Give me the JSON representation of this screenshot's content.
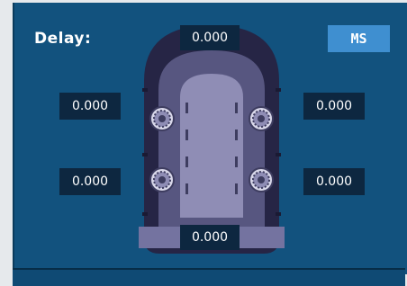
{
  "title": "Delay:",
  "unit_button": "MS",
  "delays": {
    "center": "0.000",
    "front_left": "0.000",
    "front_right": "0.000",
    "rear_left": "0.000",
    "rear_right": "0.000",
    "subwoofer": "0.000"
  },
  "icons": {
    "speaker": "speaker-icon"
  },
  "colors": {
    "panel": "#12527e",
    "button": "#3f8fd0",
    "value_box": "#0d2740"
  }
}
